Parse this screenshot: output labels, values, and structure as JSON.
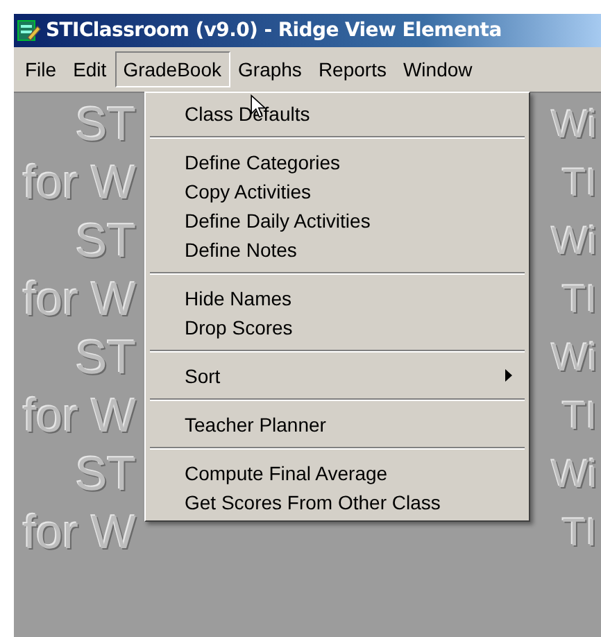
{
  "window": {
    "title": "STIClassroom (v9.0) - Ridge View Elementa"
  },
  "menubar": [
    {
      "label": "File",
      "selected": false
    },
    {
      "label": "Edit",
      "selected": false
    },
    {
      "label": "GradeBook",
      "selected": true
    },
    {
      "label": "Graphs",
      "selected": false
    },
    {
      "label": "Reports",
      "selected": false
    },
    {
      "label": "Window",
      "selected": false
    }
  ],
  "background_rows": [
    {
      "left": "ST",
      "right": "Wi"
    },
    {
      "left": "for W",
      "right": "TI"
    },
    {
      "left": "ST",
      "right": "Wi"
    },
    {
      "left": "for W",
      "right": "TI"
    },
    {
      "left": "ST",
      "right": "Wi"
    },
    {
      "left": "for W",
      "right": "TI"
    },
    {
      "left": "ST",
      "right": "Wi"
    },
    {
      "left": "for W",
      "right": "TI"
    }
  ],
  "menu": {
    "groups": [
      [
        {
          "label": "Class Defaults",
          "has_submenu": false
        }
      ],
      [
        {
          "label": "Define Categories",
          "has_submenu": false
        },
        {
          "label": "Copy Activities",
          "has_submenu": false
        },
        {
          "label": "Define Daily Activities",
          "has_submenu": false
        },
        {
          "label": "Define Notes",
          "has_submenu": false
        }
      ],
      [
        {
          "label": "Hide Names",
          "has_submenu": false
        },
        {
          "label": "Drop Scores",
          "has_submenu": false
        }
      ],
      [
        {
          "label": "Sort",
          "has_submenu": true
        }
      ],
      [
        {
          "label": "Teacher Planner",
          "has_submenu": false
        }
      ],
      [
        {
          "label": "Compute Final Average",
          "has_submenu": false
        },
        {
          "label": "Get Scores From Other Class",
          "has_submenu": false
        }
      ]
    ]
  }
}
